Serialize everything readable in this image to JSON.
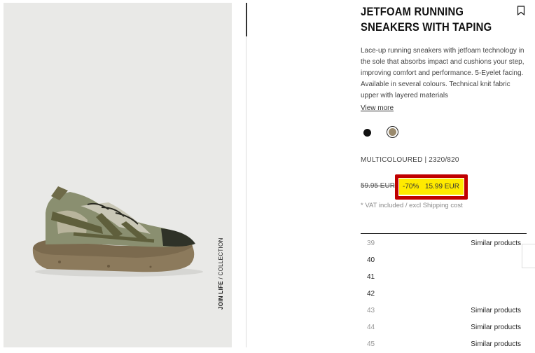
{
  "product": {
    "title": "JETFOAM RUNNING SNEAKERS WITH TAPING",
    "description": "Lace-up running sneakers with jetfoam technology in the sole that absorbs impact and cushions your step, improving comfort and performance. 5-Eyelet facing. Available in several colours. Technical knit fabric upper with layered materials",
    "view_more": "View more",
    "side_label_bold": "JOIN LIFE",
    "side_label_rest": " / COLLECTION",
    "color_code": "MULTICOLOURED | 2320/820",
    "old_price": "59.95 EUR",
    "discount": "-70%",
    "new_price": "15.99 EUR",
    "vat_note": "* VAT included / excl Shipping cost"
  },
  "swatches": [
    {
      "name": "black",
      "color": "#111111",
      "selected": false
    },
    {
      "name": "multicoloured",
      "color": "#9a8a6d",
      "selected": true
    }
  ],
  "sizes": [
    {
      "size": "39",
      "available": false,
      "label": "Similar products"
    },
    {
      "size": "40",
      "available": true,
      "label": ""
    },
    {
      "size": "41",
      "available": true,
      "label": ""
    },
    {
      "size": "42",
      "available": true,
      "label": ""
    },
    {
      "size": "43",
      "available": false,
      "label": "Similar products"
    },
    {
      "size": "44",
      "available": false,
      "label": "Similar products"
    },
    {
      "size": "45",
      "available": false,
      "label": "Similar products"
    }
  ],
  "colors": {
    "highlight": "#ffea00",
    "highlight_border": "#c00000",
    "photo_bg": "#e9e9e7"
  },
  "icons": {
    "bookmark": "bookmark-icon"
  }
}
